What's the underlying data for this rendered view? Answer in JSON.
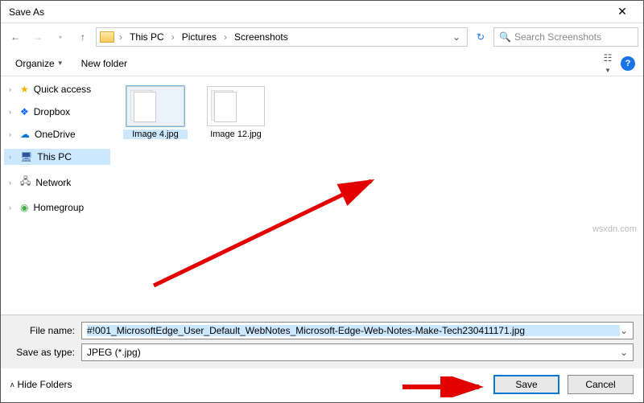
{
  "title": "Save As",
  "breadcrumbs": [
    "This PC",
    "Pictures",
    "Screenshots"
  ],
  "search_placeholder": "Search Screenshots",
  "toolbar": {
    "organize": "Organize",
    "newfolder": "New folder"
  },
  "sidebar": {
    "items": [
      {
        "label": "Quick access"
      },
      {
        "label": "Dropbox"
      },
      {
        "label": "OneDrive"
      },
      {
        "label": "This PC"
      },
      {
        "label": "Network"
      },
      {
        "label": "Homegroup"
      }
    ]
  },
  "files": [
    {
      "label": "Image 4.jpg"
    },
    {
      "label": "Image 12.jpg"
    }
  ],
  "form": {
    "filename_label": "File name:",
    "filename_value": "#!001_MicrosoftEdge_User_Default_WebNotes_Microsoft-Edge-Web-Notes-Make-Tech230411171.jpg",
    "type_label": "Save as type:",
    "type_value": "JPEG (*.jpg)"
  },
  "actions": {
    "hide_folders": "Hide Folders",
    "save": "Save",
    "cancel": "Cancel"
  },
  "watermark": "wsxdn.com"
}
